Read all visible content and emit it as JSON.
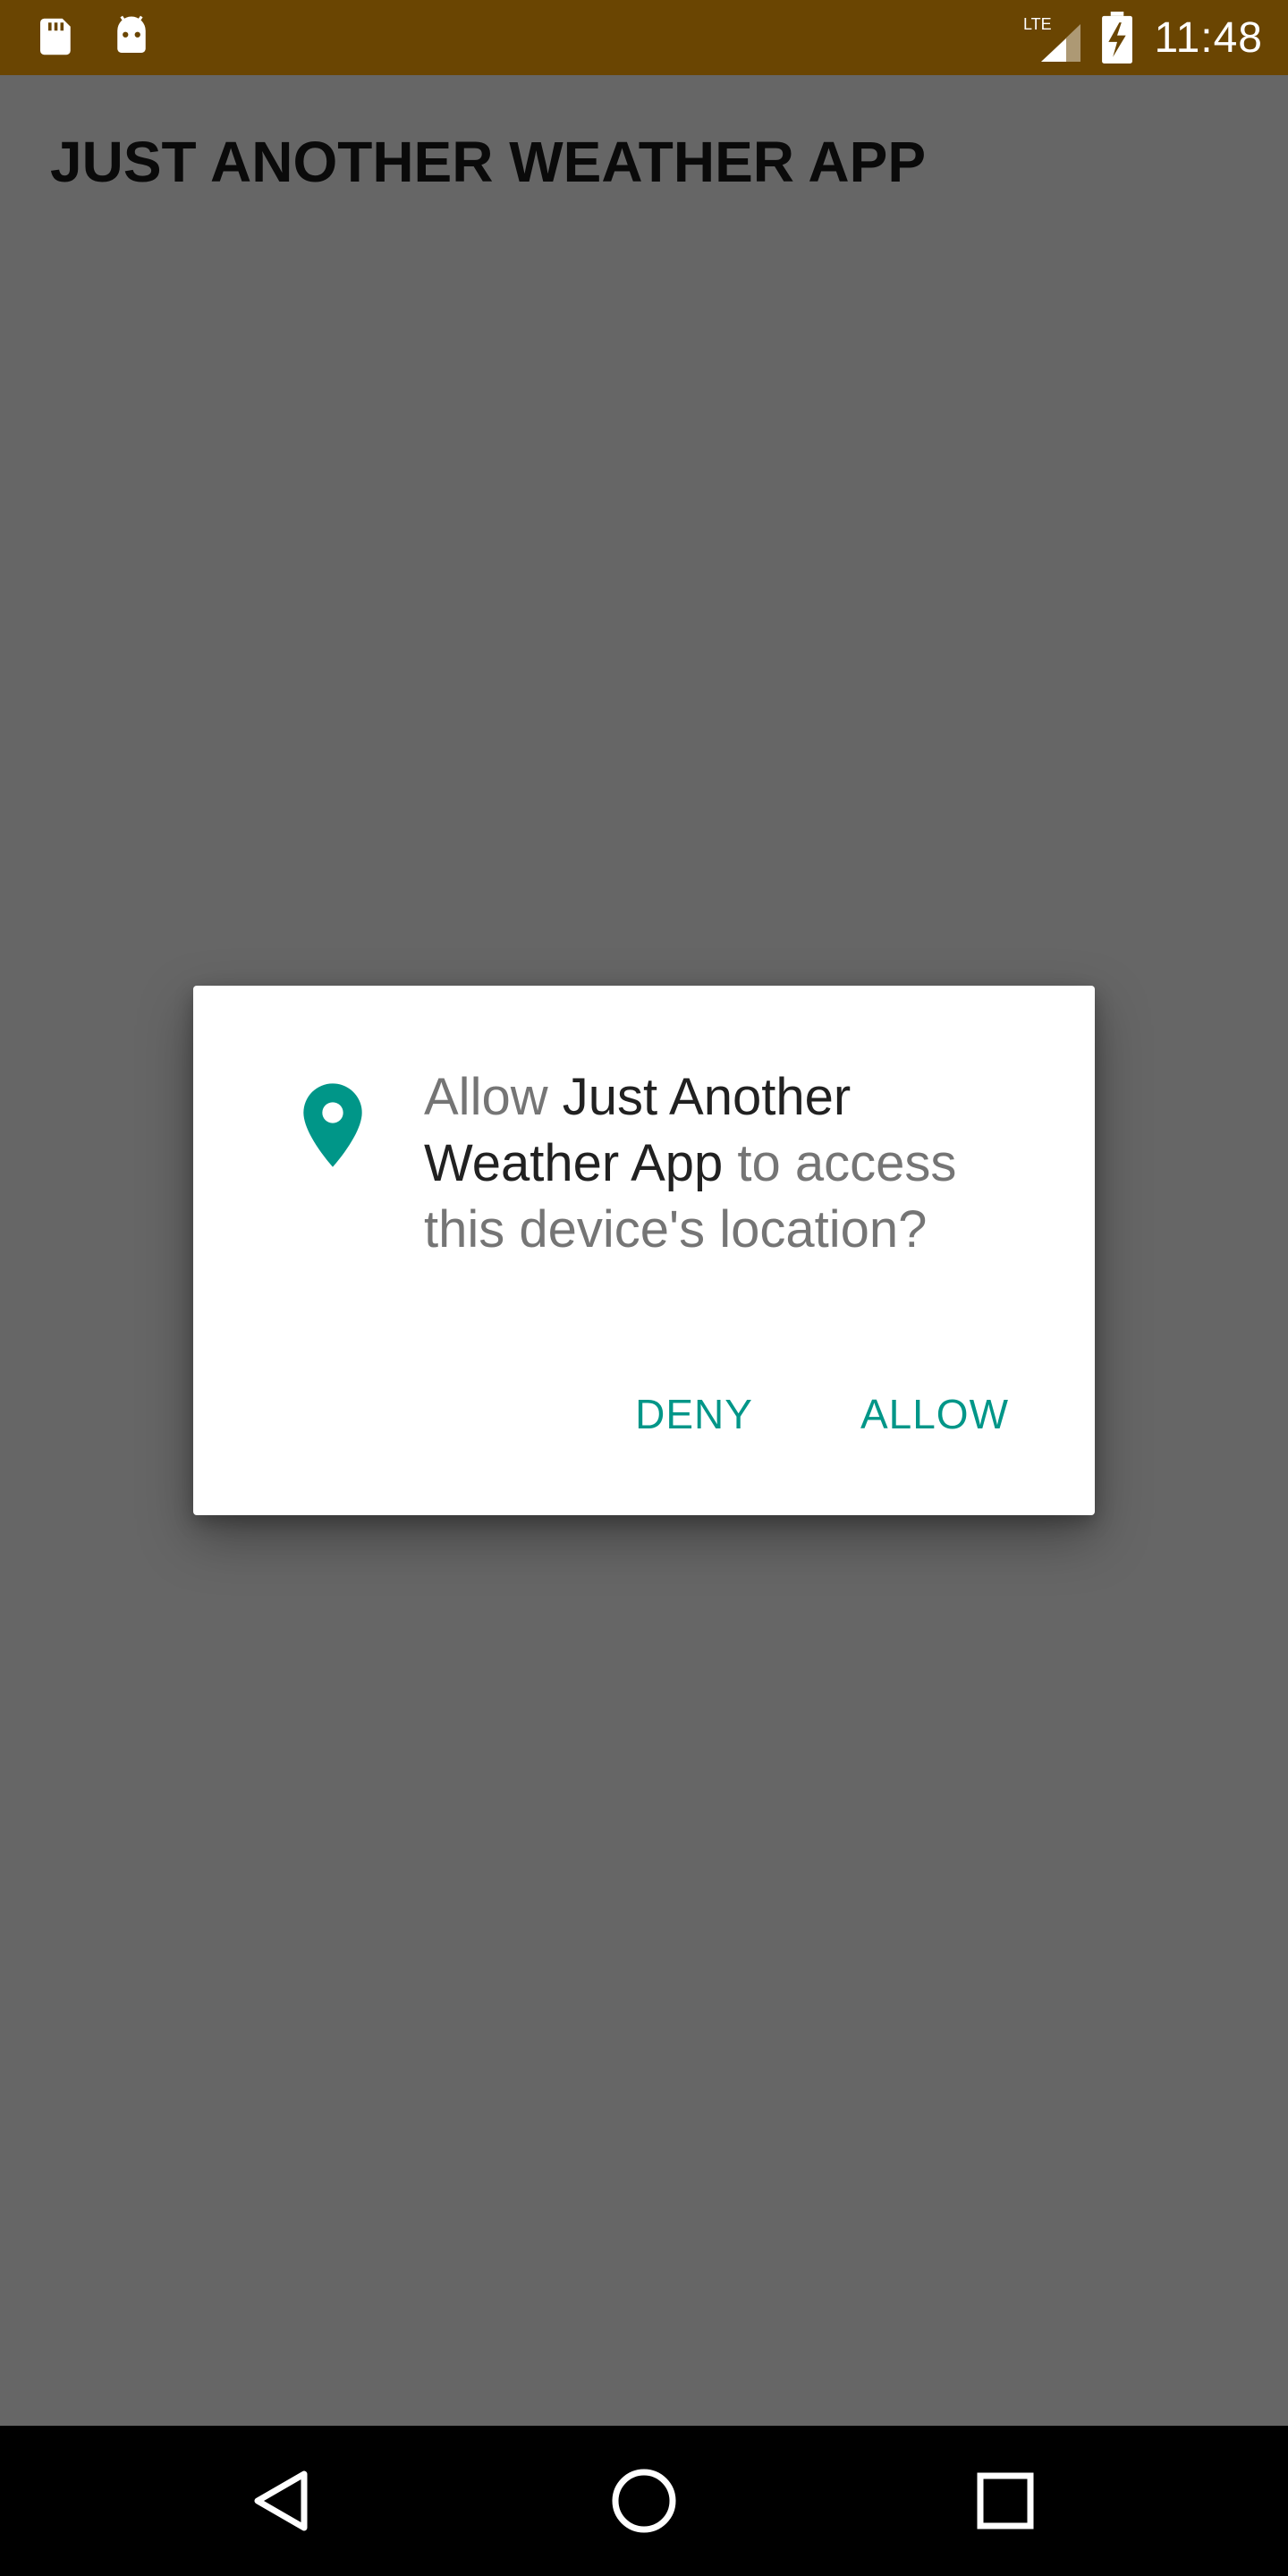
{
  "status_bar": {
    "left_icons": [
      "sd-card-icon",
      "android-icon"
    ],
    "right_icons": [
      "lte-signal-icon",
      "battery-charging-icon"
    ],
    "network_label": "LTE",
    "time": "11:48",
    "background_color": "#6a4502"
  },
  "app_bar": {
    "title": "JUST ANOTHER WEATHER APP"
  },
  "permission_dialog": {
    "icon": "location-pin-icon",
    "accent_color": "#009688",
    "message_prefix": "Allow ",
    "app_name": "Just Another Weather App",
    "message_suffix": " to access this device's location?",
    "deny_label": "DENY",
    "allow_label": "ALLOW"
  },
  "nav_bar": {
    "buttons": [
      "back-icon",
      "home-icon",
      "recents-icon"
    ]
  }
}
